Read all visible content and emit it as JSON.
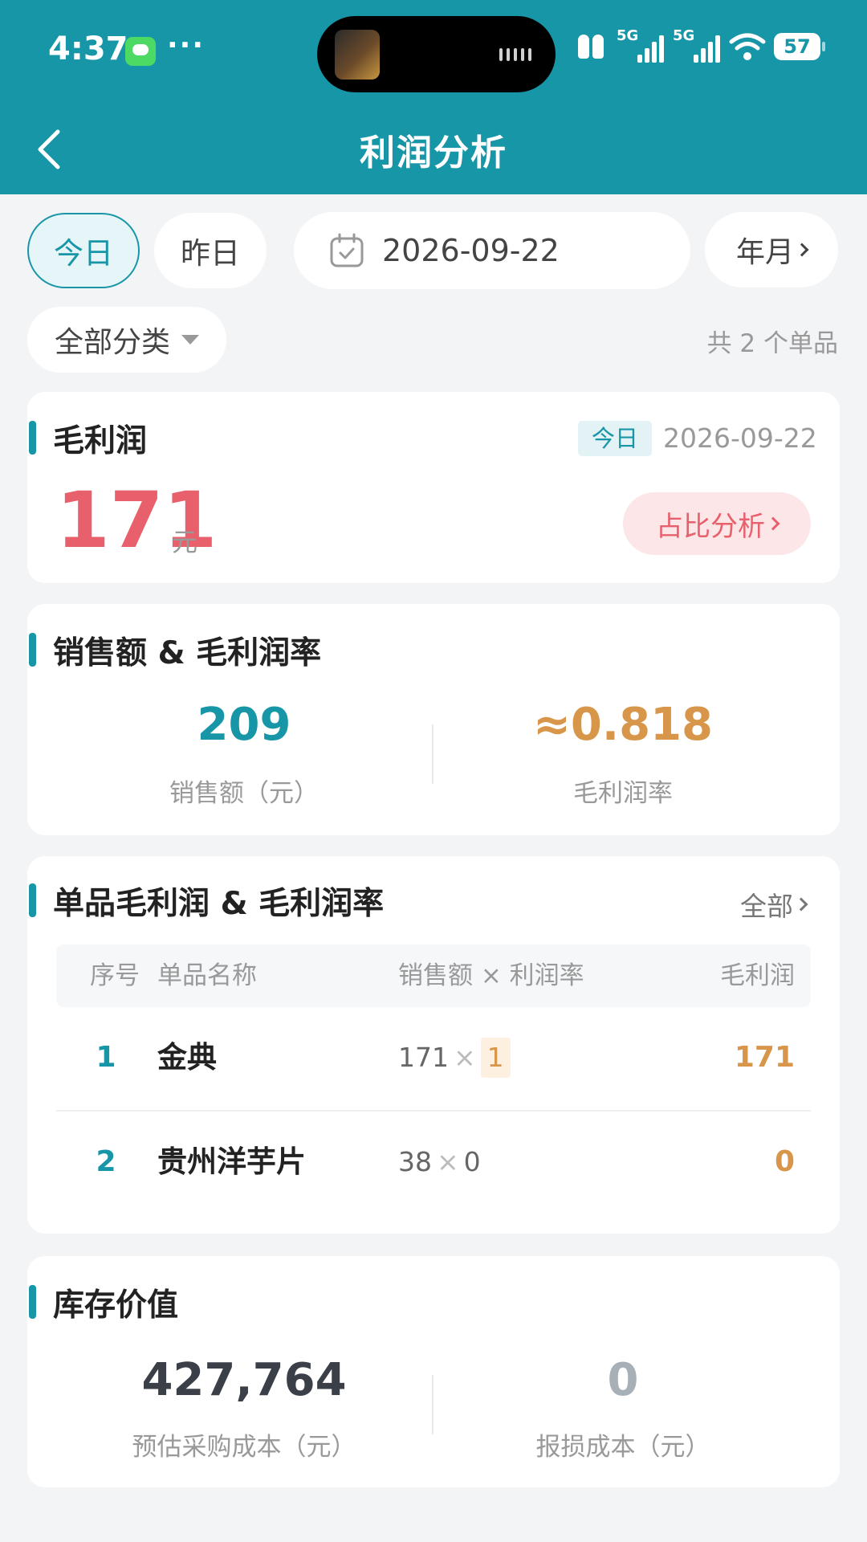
{
  "status_bar": {
    "time": "4:37",
    "dots": "···",
    "network_1": "5G",
    "network_2": "5G",
    "battery": "57"
  },
  "nav": {
    "title": "利润分析"
  },
  "filters": {
    "today": "今日",
    "yesterday": "昨日",
    "date": "2026-09-22",
    "year_month": "年月",
    "category": "全部分类",
    "count_text": "共 2 个单品"
  },
  "gross_profit": {
    "title": "毛利润",
    "badge": "今日",
    "date": "2026-09-22",
    "value": "171",
    "unit": "元",
    "ratio_button": "占比分析"
  },
  "sales": {
    "title": "销售额 & 毛利润率",
    "sales_value": "209",
    "sales_label": "销售额（元）",
    "margin_value": "≈0.818",
    "margin_label": "毛利润率"
  },
  "items": {
    "title": "单品毛利润 & 毛利润率",
    "all_link": "全部",
    "headers": {
      "index": "序号",
      "name": "单品名称",
      "calc": "销售额 × 利润率",
      "profit": "毛利润"
    },
    "rows": [
      {
        "index": "1",
        "name": "金典",
        "sales": "171",
        "times": "×",
        "rate": "1",
        "profit": "171"
      },
      {
        "index": "2",
        "name": "贵州洋芋片",
        "sales": "38",
        "times": "×",
        "rate": "0",
        "profit": "0"
      }
    ]
  },
  "inventory": {
    "title": "库存价值",
    "cost_value": "427,764",
    "cost_label": "预估采购成本（元）",
    "loss_value": "0",
    "loss_label": "报损成本（元）"
  },
  "colors": {
    "primary": "#1796a8",
    "profit_red": "#e8606c",
    "accent_orange": "#d8964a"
  }
}
